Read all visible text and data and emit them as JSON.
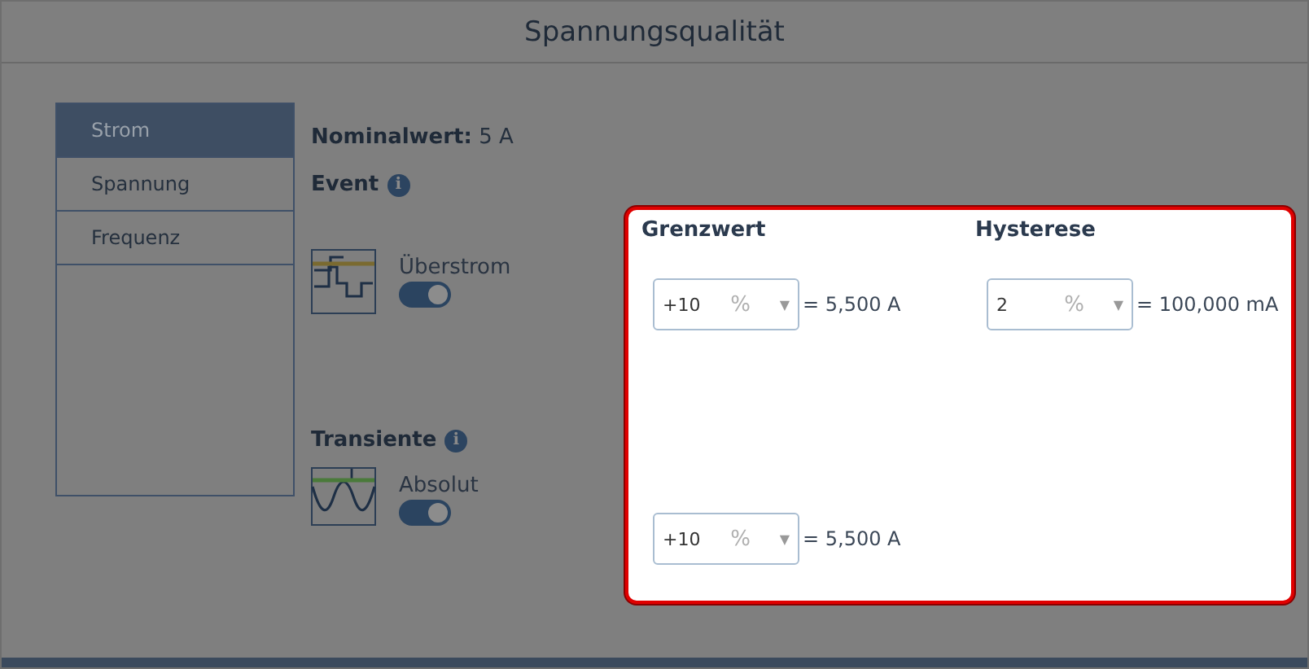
{
  "window": {
    "title": "Spannungsqualität"
  },
  "sidebar": {
    "items": [
      {
        "label": "Strom",
        "selected": true
      },
      {
        "label": "Spannung",
        "selected": false
      },
      {
        "label": "Frequenz",
        "selected": false
      }
    ]
  },
  "nominal": {
    "label": "Nominalwert:",
    "value": "5 A"
  },
  "sections": [
    {
      "title": "Event",
      "info": "i",
      "items": [
        {
          "kind": "step",
          "label": "Überstrom",
          "on": true
        }
      ]
    },
    {
      "title": "Transiente",
      "info": "i",
      "items": [
        {
          "kind": "sine",
          "label": "Absolut",
          "on": true
        }
      ]
    }
  ],
  "limits": {
    "headers": [
      "Grenzwert",
      "Hysterese"
    ],
    "rows": [
      [
        {
          "value": "+10",
          "unit": "%",
          "arrow": "▼",
          "result": "= 5,500 A"
        },
        {
          "value": "2",
          "unit": "%",
          "arrow": "▼",
          "result": "= 100,000 mA"
        }
      ],
      [
        {
          "value": "+10",
          "unit": "%",
          "arrow": "▼",
          "result": "= 5,500 A"
        }
      ]
    ]
  }
}
